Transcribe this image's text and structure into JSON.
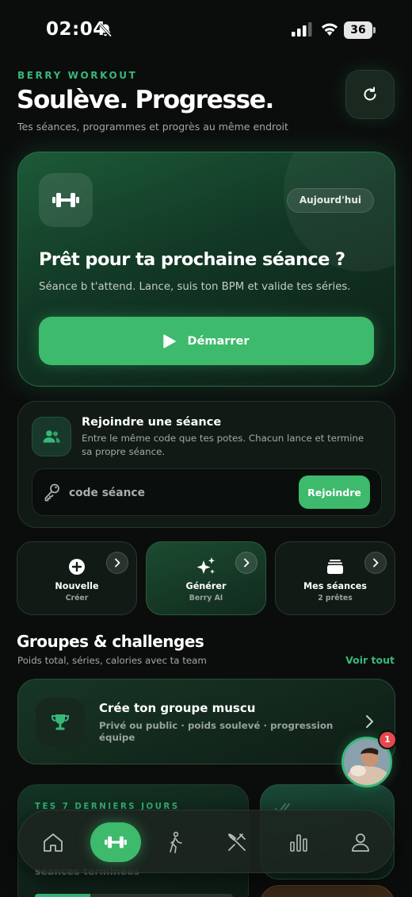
{
  "status_bar": {
    "time": "02:04",
    "battery": "36"
  },
  "header": {
    "eyebrow": "BERRY WORKOUT",
    "title": "Soulève. Progresse.",
    "subtitle": "Tes séances, programmes et progrès au même endroit"
  },
  "hero": {
    "badge": "Aujourd'hui",
    "title": "Prêt pour ta prochaine séance ?",
    "description": "Séance b t'attend. Lance, suis ton BPM et valide tes séries.",
    "start_label": "Démarrer"
  },
  "join": {
    "title": "Rejoindre une séance",
    "description": "Entre le même code que tes potes. Chacun lance et termine sa propre séance.",
    "placeholder": "code séance",
    "button_label": "Rejoindre"
  },
  "quick_actions": [
    {
      "label": "Nouvelle",
      "sub": "Créer",
      "icon": "plus-circle-icon"
    },
    {
      "label": "Générer",
      "sub": "Berry AI",
      "icon": "sparkles-icon"
    },
    {
      "label": "Mes séances",
      "sub": "2 prêtes",
      "icon": "stack-icon"
    }
  ],
  "groups": {
    "title": "Groupes & challenges",
    "subtitle": "Poids total, séries, calories avec ta team",
    "see_all": "Voir tout",
    "card_title": "Crée ton groupe muscu",
    "card_desc": "Privé ou public · poids soulevé · progression équipe",
    "notification_count": "1"
  },
  "week": {
    "eyebrow": "TES 7 DERNIERS JOURS",
    "subtitle": "séances terminées",
    "progress_fraction": 0.28
  },
  "tabs": [
    {
      "name": "home",
      "icon": "home-icon"
    },
    {
      "name": "workout",
      "icon": "dumbbell-icon",
      "active": true
    },
    {
      "name": "walk",
      "icon": "walking-icon"
    },
    {
      "name": "nutrition",
      "icon": "fork-knife-icon"
    },
    {
      "name": "stats",
      "icon": "bar-chart-icon"
    },
    {
      "name": "profile",
      "icon": "person-icon"
    }
  ],
  "colors": {
    "accent": "#37b87a",
    "button": "#3dba6c",
    "background": "#0b0d0c",
    "badge": "#e5484d"
  }
}
